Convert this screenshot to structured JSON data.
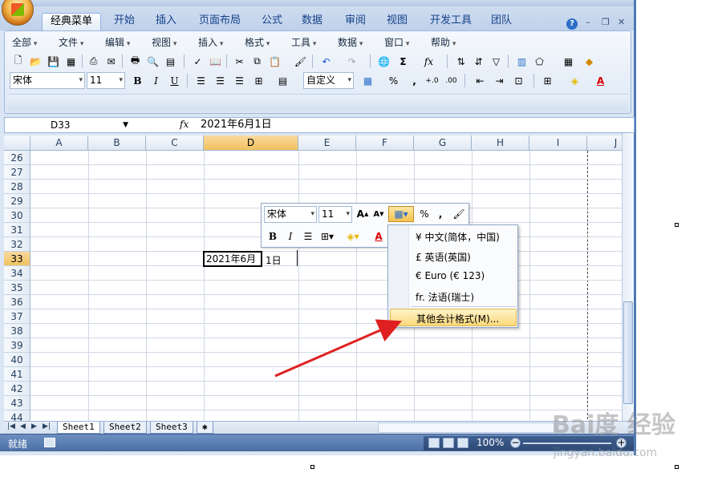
{
  "ribbon_tabs": [
    "经典菜单",
    "开始",
    "插入",
    "页面布局",
    "公式",
    "数据",
    "审阅",
    "视图",
    "开发工具",
    "团队"
  ],
  "menu": [
    "全部",
    "文件",
    "编辑",
    "视图",
    "插入",
    "格式",
    "工具",
    "数据",
    "窗口",
    "帮助"
  ],
  "toolbar": {
    "font_name": "宋体",
    "font_size": "11",
    "number_format": "自定义",
    "bold": "B",
    "italic": "I",
    "underline": "U",
    "percent": "%",
    "comma": ","
  },
  "formula_bar": {
    "name_box": "D33",
    "fx": "fx",
    "formula": "2021年6月1日"
  },
  "columns": [
    "A",
    "B",
    "C",
    "D",
    "E",
    "F",
    "G",
    "H",
    "I",
    "J"
  ],
  "selected_column": "D",
  "rows": [
    "26",
    "27",
    "28",
    "29",
    "30",
    "31",
    "32",
    "33",
    "34",
    "35",
    "36",
    "37",
    "38",
    "39",
    "40",
    "41",
    "42",
    "43",
    "44"
  ],
  "selected_row": "33",
  "active_cell": {
    "text_a": "2021年6月",
    "text_b": "1日"
  },
  "mini_toolbar": {
    "font_name": "宋体",
    "font_size": "11",
    "percent": "%",
    "comma": ",",
    "bold": "B",
    "italic": "I"
  },
  "currency_dropdown": {
    "items": [
      "¥ 中文(简体，中国)",
      "£ 英语(英国)",
      "€ Euro (€ 123)",
      "fr. 法语(瑞士)"
    ],
    "more": "其他会计格式(M)..."
  },
  "sheets": [
    "Sheet1",
    "Sheet2",
    "Sheet3"
  ],
  "status": {
    "ready": "就绪",
    "zoom": "100%"
  },
  "watermark": {
    "logo": "Bai度 经验",
    "url": "jingyan.baidu.com"
  },
  "colors": {
    "accent": "#f1c15f",
    "arrow": "#e02020",
    "status_bar": "#4a6fa5"
  }
}
